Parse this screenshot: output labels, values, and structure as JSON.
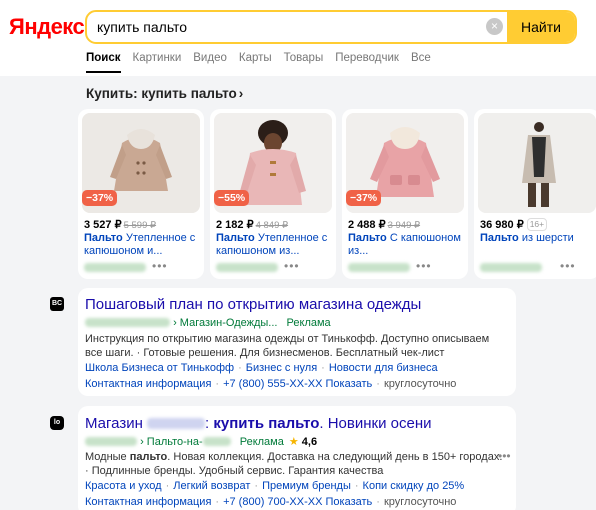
{
  "header": {
    "logo": "Яндекс",
    "search_value": "купить пальто",
    "clear_icon": "×",
    "search_button": "Найти"
  },
  "tabs": [
    "Поиск",
    "Картинки",
    "Видео",
    "Карты",
    "Товары",
    "Переводчик",
    "Все"
  ],
  "shopping": {
    "title": "Купить: купить пальто",
    "chevron": "›",
    "products": [
      {
        "discount": "−37%",
        "price": "3 527 ₽",
        "old_price": "5 599 ₽",
        "title_bold": "Пальто",
        "title_rest": " Утепленное с капюшоном и...",
        "more": "•••"
      },
      {
        "discount": "−55%",
        "price": "2 182 ₽",
        "old_price": "4 849 ₽",
        "title_bold": "Пальто",
        "title_rest": " Утепленное с капюшоном из...",
        "more": "•••"
      },
      {
        "discount": "−37%",
        "price": "2 488 ₽",
        "old_price": "3 949 ₽",
        "title_bold": "Пальто",
        "title_rest": " С капюшоном из...",
        "more": "•••"
      },
      {
        "price": "36 980 ₽",
        "age_badge": "16+",
        "title_bold": "Пальто",
        "title_rest": " из шерсти",
        "more": "•••"
      }
    ]
  },
  "results": [
    {
      "favicon": "BC",
      "title": "Пошаговый план по открытию магазина одежды",
      "url_sep": "›",
      "url_path": "Магазин-Одежды...",
      "ad_label": "Реклама",
      "description": "Инструкция по открытию магазина одежды от Тинькофф. Доступно описываем все шаги. · Готовые решения. Для бизнесменов. Бесплатный чек-лист",
      "links": [
        "Школа Бизнеса от Тинькофф",
        "Бизнес с нуля",
        "Новости для бизнеса"
      ],
      "contact_label": "Контактная информация",
      "phone": "+7 (800) 555-XX-XX",
      "show": "Показать",
      "hours": "круглосуточно"
    },
    {
      "favicon": "lo",
      "title_prefix": "Магазин ",
      "title_bold": "купить пальто",
      "title_suffix": ". Новинки осени",
      "url_sep": "›",
      "url_path": "Пальто-на-",
      "ad_label": "Реклама",
      "star": "★",
      "rating": "4,6",
      "description_bold": "Модные ",
      "description_word": "пальто",
      "description_rest": ". Новая коллекция. Доставка на следующий день в 150+ городах. · Подлинные бренды. Удобный сервис. Гарантия качества",
      "links": [
        "Красота и уход",
        "Легкий возврат",
        "Премиум бренды",
        "Копи скидку до 25%"
      ],
      "contact_label": "Контактная информация",
      "phone": "+7 (800) 700-XX-XX",
      "show": "Показать",
      "hours": "круглосуточно",
      "more": "•••"
    }
  ]
}
